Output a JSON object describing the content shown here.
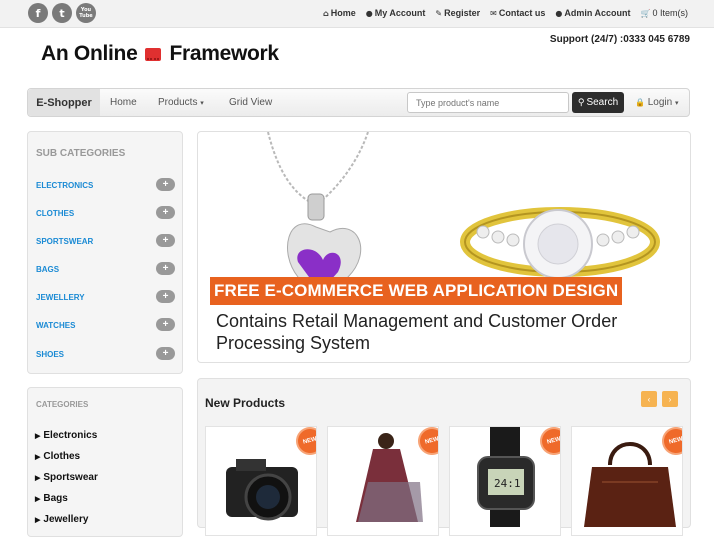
{
  "topbar": {
    "social": [
      "f",
      "t",
      "You Tube"
    ],
    "links": [
      {
        "icon": "home-icon",
        "label": "Home"
      },
      {
        "icon": "user-icon",
        "label": "My Account"
      },
      {
        "icon": "edit-icon",
        "label": "Register"
      },
      {
        "icon": "envelope-icon",
        "label": "Contact us"
      },
      {
        "icon": "user-icon",
        "label": "Admin Account"
      },
      {
        "icon": "cart-icon",
        "label": "0 Item(s)"
      }
    ]
  },
  "header": {
    "support": "Support (24/7) :0333 045 6789",
    "logo_left": "An Online",
    "logo_right": "Framework"
  },
  "navbar": {
    "brand": "E-Shopper",
    "home": "Home",
    "products": "Products",
    "grid": "Grid View",
    "search_placeholder": "Type product's name",
    "search_btn": "Search",
    "login": "Login"
  },
  "sidebar": {
    "subcat_title": "SUB CATEGORIES",
    "subcats": [
      "ELECTRONICS",
      "CLOTHES",
      "SPORTSWEAR",
      "BAGS",
      "JEWELLERY",
      "WATCHES",
      "SHOES"
    ],
    "cat_title": "CATEGORIES",
    "cats": [
      "Electronics",
      "Clothes",
      "Sportswear",
      "Bags",
      "Jewellery"
    ]
  },
  "hero": {
    "banner": "FREE E-COMMERCE WEB APPLICATION DESIGN",
    "subtitle": "Contains Retail Management and Customer Order Processing System"
  },
  "new_products": {
    "title": "New Products",
    "badge": "NEW",
    "prev": "‹",
    "next": "›",
    "items": [
      "camera",
      "dress",
      "watch",
      "bag"
    ]
  },
  "colors": {
    "accent_orange": "#e8621f",
    "link_blue": "#1a8ad4",
    "arrow_yellow": "#f6b351"
  }
}
